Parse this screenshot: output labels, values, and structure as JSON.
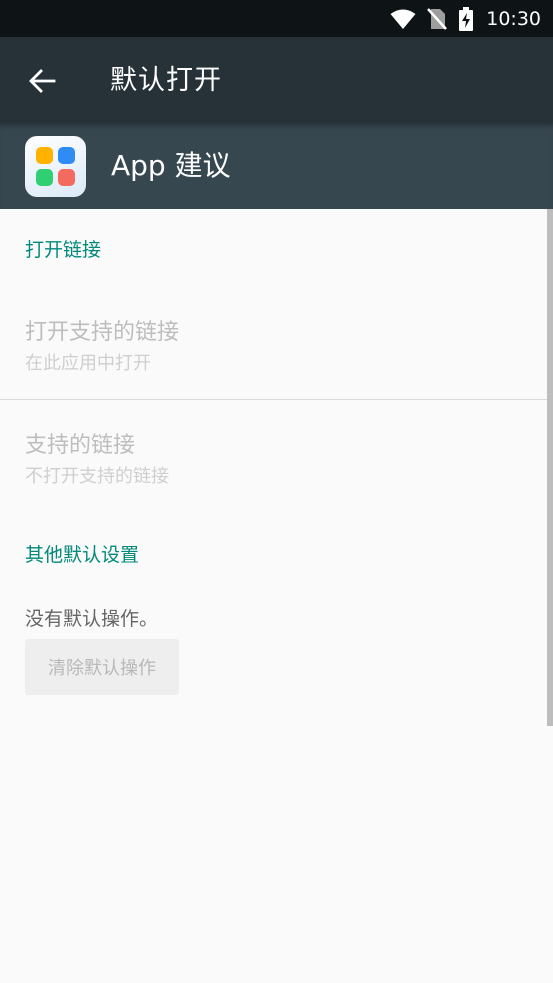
{
  "status_bar": {
    "time": "10:30",
    "icons": [
      "wifi-icon",
      "no-sim-icon",
      "battery-charging-icon"
    ]
  },
  "app_bar": {
    "back_icon": "arrow-left-icon",
    "title": "默认打开"
  },
  "app_header": {
    "app_name": "App 建议",
    "icon_colors": [
      "#ffb300",
      "#2f8cf5",
      "#2fcf72",
      "#f26b5e"
    ]
  },
  "sections": {
    "open_links": {
      "header": "打开链接",
      "open_supported": {
        "title": "打开支持的链接",
        "summary": "在此应用中打开"
      },
      "supported_links": {
        "title": "支持的链接",
        "summary": "不打开支持的链接"
      }
    },
    "other_defaults": {
      "header": "其他默认设置",
      "message": "没有默认操作。",
      "clear_button": "清除默认操作"
    }
  },
  "colors": {
    "app_bar": "#263238",
    "app_header": "#37474f",
    "accent": "#00897b"
  }
}
